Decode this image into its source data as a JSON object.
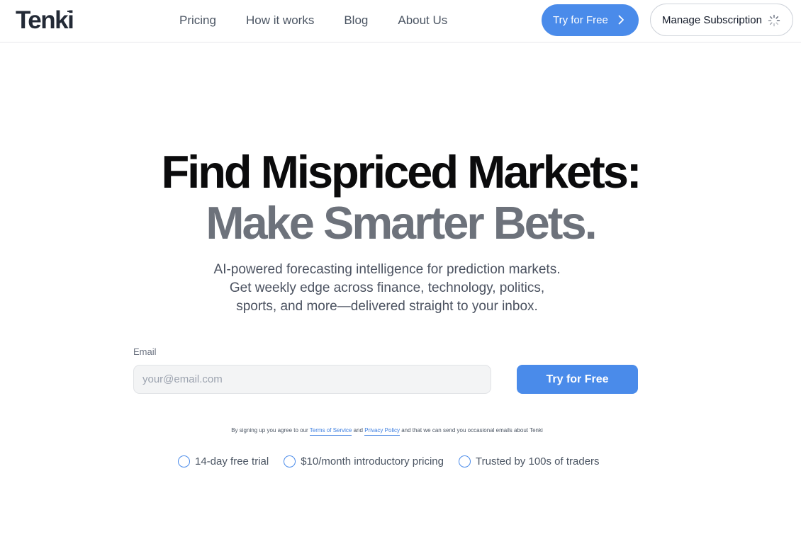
{
  "header": {
    "logo_text": "Tenki",
    "nav": [
      "Pricing",
      "How it works",
      "Blog",
      "About Us"
    ],
    "try_label": "Try for Free",
    "manage_label": "Manage Subscription"
  },
  "hero": {
    "headline_1": "Find Mispriced Markets:",
    "headline_2": "Make Smarter Bets.",
    "sub_1": "AI-powered forecasting intelligence for prediction markets.",
    "sub_2": "Get weekly edge across finance, technology, politics,",
    "sub_3": "sports, and more—delivered straight to your inbox."
  },
  "form": {
    "email_label": "Email",
    "email_placeholder": "your@email.com",
    "submit_label": "Try for Free",
    "legal_prefix": "By signing up you agree to our",
    "terms_link": "Terms of Service",
    "legal_and": "and",
    "privacy_link": "Privacy Policy",
    "legal_suffix": "and that we can send you occasional emails about Tenki"
  },
  "features": [
    "14-day free trial",
    "$10/month introductory pricing",
    "Trusted by 100s of traders"
  ],
  "colors": {
    "accent": "#4a8bea",
    "headline": "#0b0b0c",
    "headline_muted": "#6d727b"
  }
}
